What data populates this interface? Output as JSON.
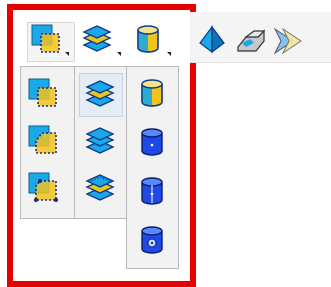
{
  "window": {
    "title": "",
    "highlight_color": "#e60000"
  },
  "toolbar": {
    "items": [
      {
        "icon": "region-offset-icon",
        "has_dropdown": true,
        "selected": true
      },
      {
        "icon": "layered-stack-icon",
        "has_dropdown": true,
        "selected": false
      },
      {
        "icon": "cylinder-face-icon",
        "has_dropdown": true,
        "selected": false
      },
      {
        "icon": "pyramid-solid-icon",
        "has_dropdown": false,
        "selected": false
      },
      {
        "icon": "stepped-solid-icon",
        "has_dropdown": false,
        "selected": false
      },
      {
        "icon": "arrow-shape-icon",
        "has_dropdown": false,
        "selected": false
      }
    ]
  },
  "flyouts": {
    "region_column": [
      "region-offset-icon",
      "region-chamfer-icon",
      "region-corner-icon"
    ],
    "stack_column": [
      "layered-stack-icon",
      "layered-stack-icon",
      "layered-stack-outline-icon"
    ],
    "cylinder_column": [
      "cylinder-face-icon",
      "cylinder-solid-icon",
      "cylinder-axis-icon",
      "cylinder-end-icon"
    ]
  },
  "colors": {
    "accent_blue": "#1aa8e8",
    "accent_yellow": "#f2c31c",
    "cylinder_blue": "#1f49e6",
    "panel_bg": "#f2f2f2"
  }
}
